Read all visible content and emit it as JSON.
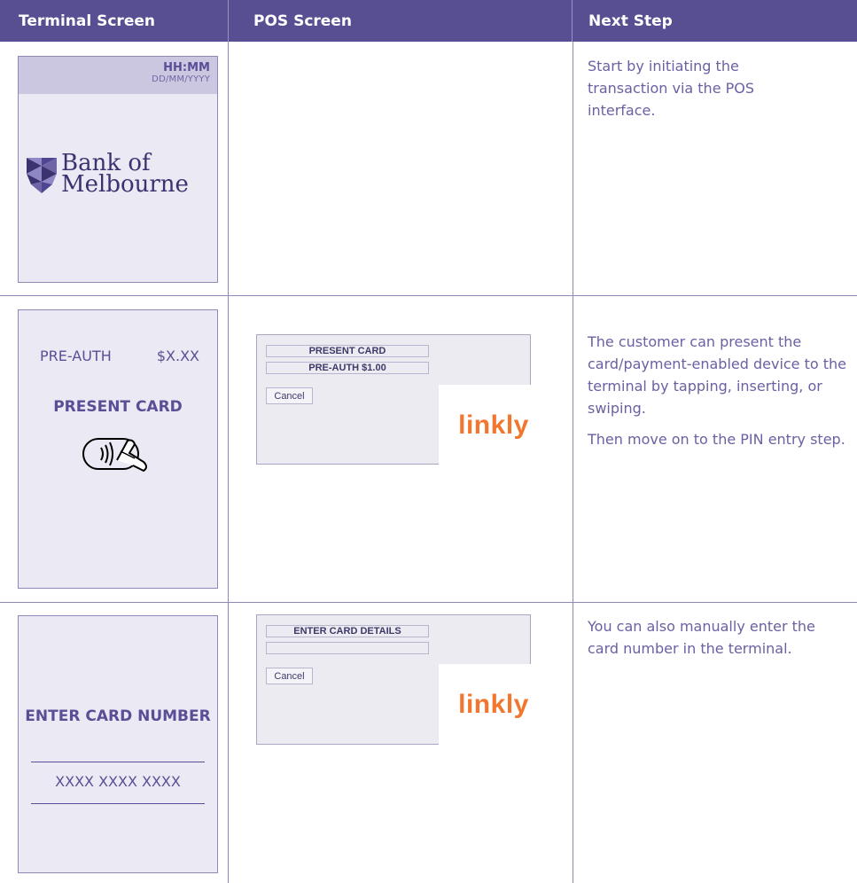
{
  "header": {
    "col1": "Terminal Screen",
    "col2": "POS Screen",
    "col3": "Next Step"
  },
  "rows": [
    {
      "terminal": {
        "time": "HH:MM",
        "date": "DD/MM/YYYY",
        "logo_text_line1": "Bank of",
        "logo_text_line2": "Melbourne"
      },
      "next_step": "Start by initiating the transaction via the POS interface."
    },
    {
      "terminal": {
        "label": "PRE-AUTH",
        "amount": "$X.XX",
        "prompt": "PRESENT CARD",
        "icon": "contactless-card-icon"
      },
      "pos": {
        "line1": "PRESENT CARD",
        "line2": "PRE-AUTH   $1.00",
        "cancel": "Cancel",
        "logo": "linkly"
      },
      "next_step": [
        "The customer can present the card/payment-enabled device to the terminal by tapping, inserting, or swiping.",
        "Then move on to the PIN entry step."
      ]
    },
    {
      "terminal": {
        "prompt": "ENTER CARD NUMBER",
        "masked": "XXXX XXXX XXXX"
      },
      "pos": {
        "line1": "ENTER CARD DETAILS",
        "line2": "",
        "cancel": "Cancel",
        "logo": "linkly"
      },
      "next_step": "You can also manually enter the card number in the terminal."
    }
  ],
  "colors": {
    "header_bg": "#584f93",
    "terminal_bg": "#ebe9f3",
    "accent_text": "#5b4e96",
    "linkly_orange": "#f2762e"
  }
}
